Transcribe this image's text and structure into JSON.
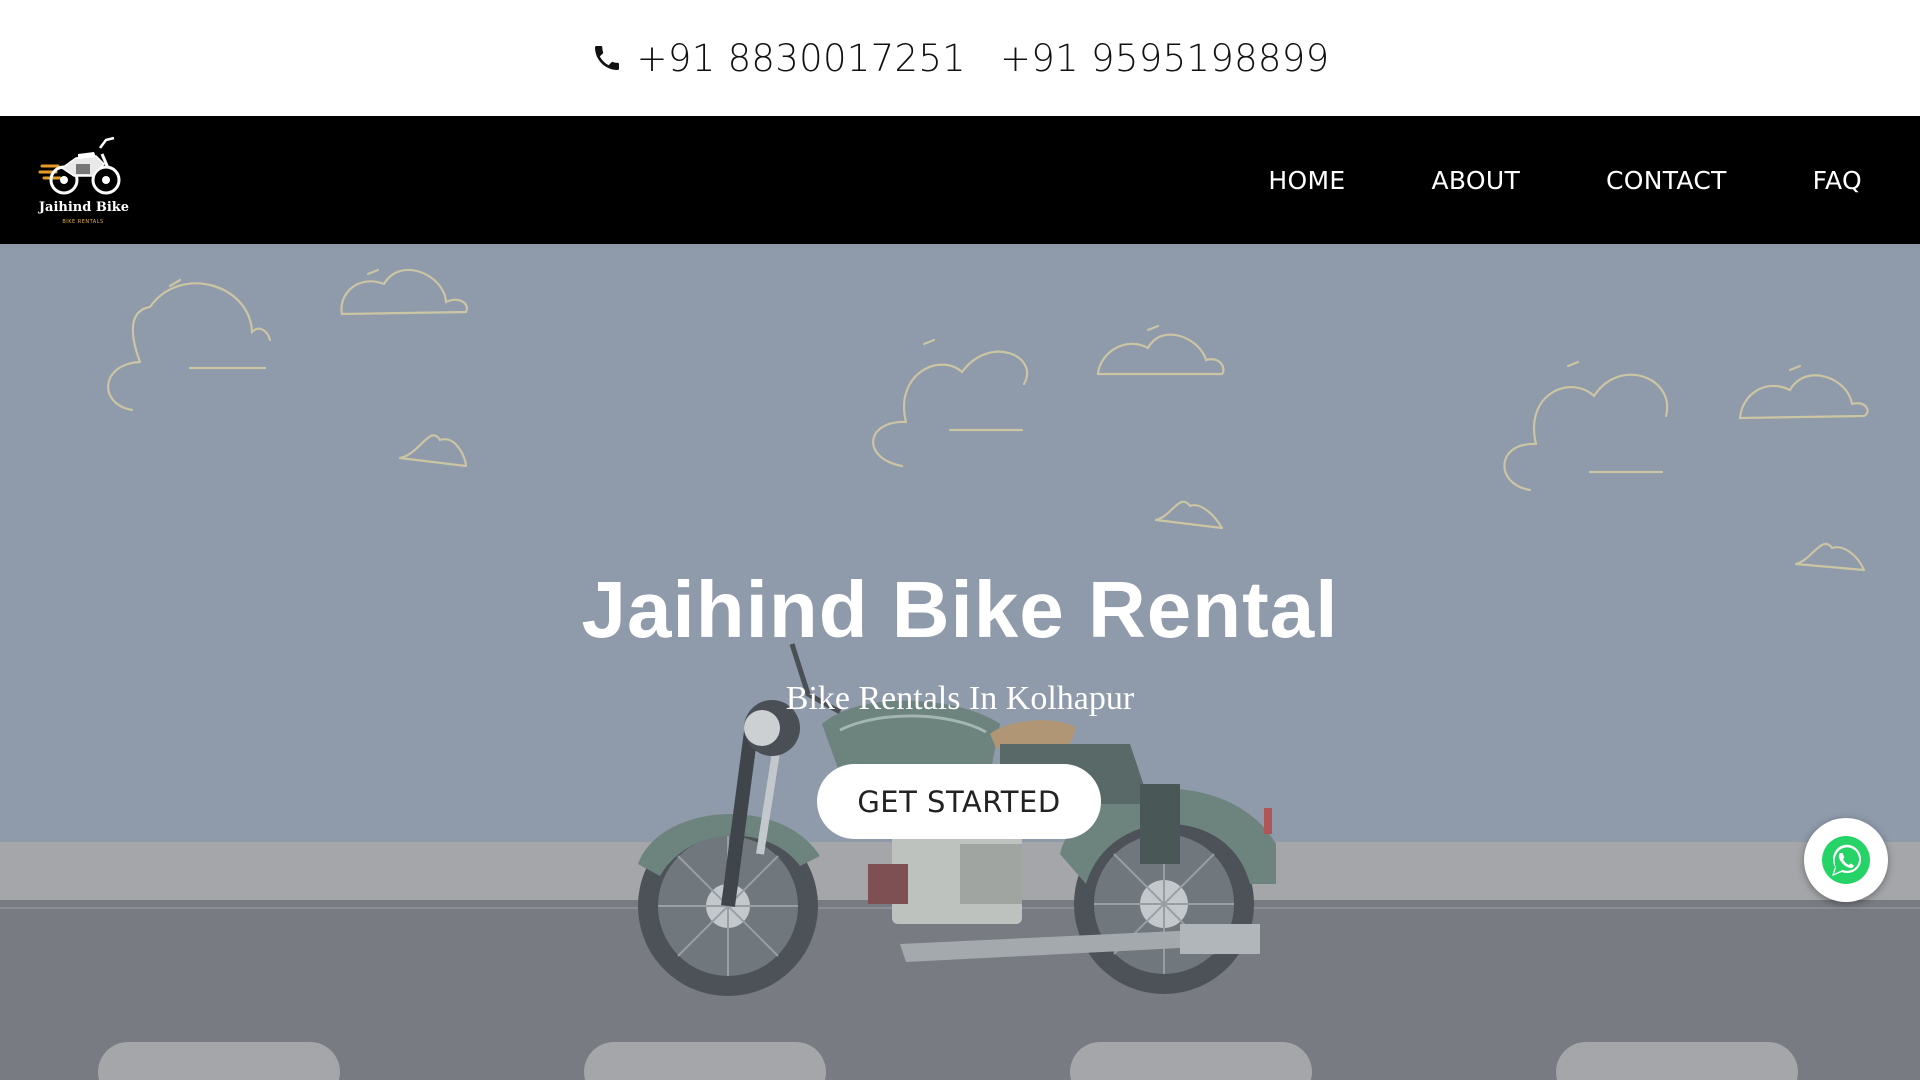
{
  "topbar": {
    "phone_icon": "phone-icon",
    "phone_1": "+91 8830017251",
    "phone_2": "+91 9595198899"
  },
  "navbar": {
    "logo_text": "Jaihind Bike",
    "logo_subtext": "BIKE RENTALS",
    "items": [
      {
        "label": "HOME"
      },
      {
        "label": "ABOUT"
      },
      {
        "label": "CONTACT"
      },
      {
        "label": "FAQ"
      }
    ]
  },
  "hero": {
    "title": "Jaihind Bike Rental",
    "subtitle": "Bike Rentals In Kolhapur",
    "cta_label": "GET STARTED"
  },
  "floating": {
    "whatsapp_icon": "whatsapp-icon"
  },
  "colors": {
    "navbar_bg": "#000000",
    "sky": "#8f9aab",
    "road": "#737579",
    "sidewalk": "#a9a9a9",
    "cloud_stroke": "#d8cfa3",
    "whatsapp_green": "#25d366"
  }
}
